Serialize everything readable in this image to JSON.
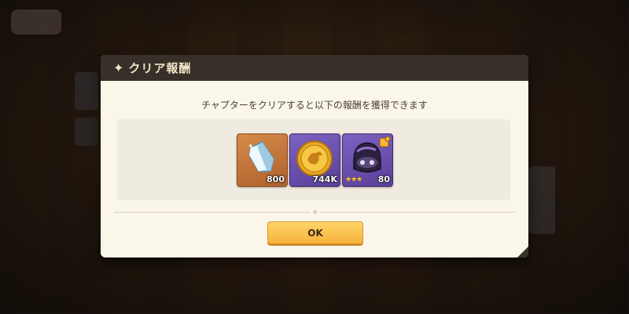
{
  "background": {
    "back_label": "",
    "crumb": ""
  },
  "dialog": {
    "title": "クリア報酬",
    "title_icon": "sparkle-icon",
    "description": "チャプターをクリアすると以下の報酬を獲得できます",
    "rewards": [
      {
        "name": "crystal",
        "icon": "blue-crystal-icon",
        "quantity": "800"
      },
      {
        "name": "gold-coin",
        "icon": "gold-coin-icon",
        "quantity": "744K"
      },
      {
        "name": "hero-piece",
        "icon": "hero-helmet-icon",
        "quantity": "80",
        "stars": "★★★"
      }
    ],
    "ok_label": "OK"
  },
  "colors": {
    "header_bg": "#363029",
    "dialog_bg": "#fbf6ea",
    "button": "#f6b43a",
    "crystal_frame": "#b0612c",
    "purple_frame": "#5a3f9a"
  }
}
